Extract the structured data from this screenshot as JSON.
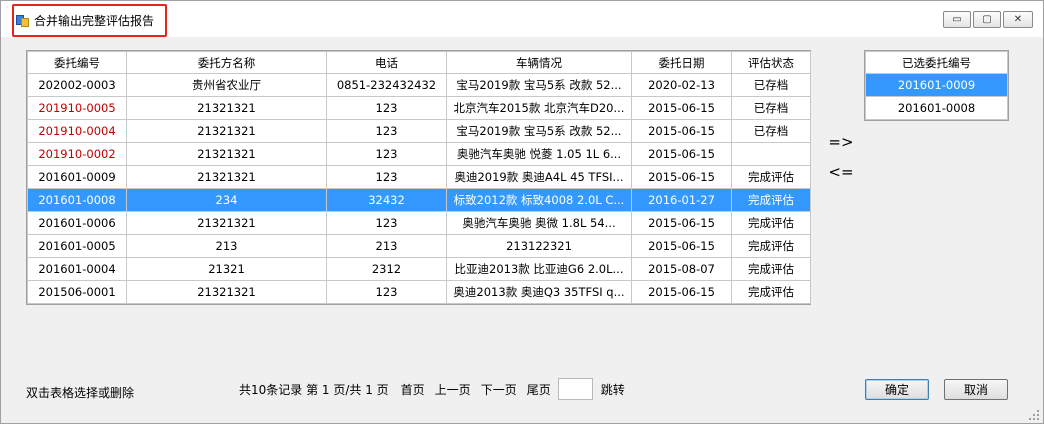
{
  "window": {
    "title": "合并输出完整评估报告",
    "buttons": {
      "minimize": "▭",
      "restore": "▢",
      "close": "✕"
    }
  },
  "grid": {
    "columns": [
      "委托编号",
      "委托方名称",
      "电话",
      "车辆情况",
      "委托日期",
      "评估状态"
    ],
    "rows": [
      {
        "cells": [
          "202002-0003",
          "贵州省农业厅",
          "0851-232432432",
          "宝马2019款 宝马5系 改款 52...",
          "2020-02-13",
          "已存档"
        ],
        "red": false,
        "selected": false
      },
      {
        "cells": [
          "201910-0005",
          "21321321",
          "123",
          "北京汽车2015款 北京汽车D20...",
          "2015-06-15",
          "已存档"
        ],
        "red": true,
        "selected": false
      },
      {
        "cells": [
          "201910-0004",
          "21321321",
          "123",
          "宝马2019款 宝马5系 改款 52...",
          "2015-06-15",
          "已存档"
        ],
        "red": true,
        "selected": false
      },
      {
        "cells": [
          "201910-0002",
          "21321321",
          "123",
          "奥驰汽车奥驰 悦菱 1.05 1L 6...",
          "2015-06-15",
          ""
        ],
        "red": true,
        "selected": false
      },
      {
        "cells": [
          "201601-0009",
          "21321321",
          "123",
          "奥迪2019款 奥迪A4L 45 TFSI...",
          "2015-06-15",
          "完成评估"
        ],
        "red": false,
        "selected": false
      },
      {
        "cells": [
          "201601-0008",
          "234",
          "32432",
          "标致2012款 标致4008 2.0L C...",
          "2016-01-27",
          "完成评估"
        ],
        "red": false,
        "selected": true
      },
      {
        "cells": [
          "201601-0006",
          "21321321",
          "123",
          "奥驰汽车奥驰 奥微 1.8L 54...",
          "2015-06-15",
          "完成评估"
        ],
        "red": false,
        "selected": false
      },
      {
        "cells": [
          "201601-0005",
          "213",
          "213",
          "213122321",
          "2015-06-15",
          "完成评估"
        ],
        "red": false,
        "selected": false
      },
      {
        "cells": [
          "201601-0004",
          "21321",
          "2312",
          "比亚迪2013款 比亚迪G6 2.0L...",
          "2015-08-07",
          "完成评估"
        ],
        "red": false,
        "selected": false
      },
      {
        "cells": [
          "201506-0001",
          "21321321",
          "123",
          "奥迪2013款 奥迪Q3 35TFSI q...",
          "2015-06-15",
          "完成评估"
        ],
        "red": false,
        "selected": false
      }
    ]
  },
  "transfer": {
    "add": "=>",
    "remove": "<="
  },
  "selected_list": {
    "header": "已选委托编号",
    "items": [
      {
        "label": "201601-0009",
        "selected": true
      },
      {
        "label": "201601-0008",
        "selected": false
      }
    ]
  },
  "footer": {
    "hint": "双击表格选择或删除",
    "record_info": "共10条记录 第 1 页/共 1 页",
    "first": "首页",
    "prev": "上一页",
    "next": "下一页",
    "last": "尾页",
    "page_input_value": "",
    "jump": "跳转",
    "ok": "确定",
    "cancel": "取消"
  }
}
